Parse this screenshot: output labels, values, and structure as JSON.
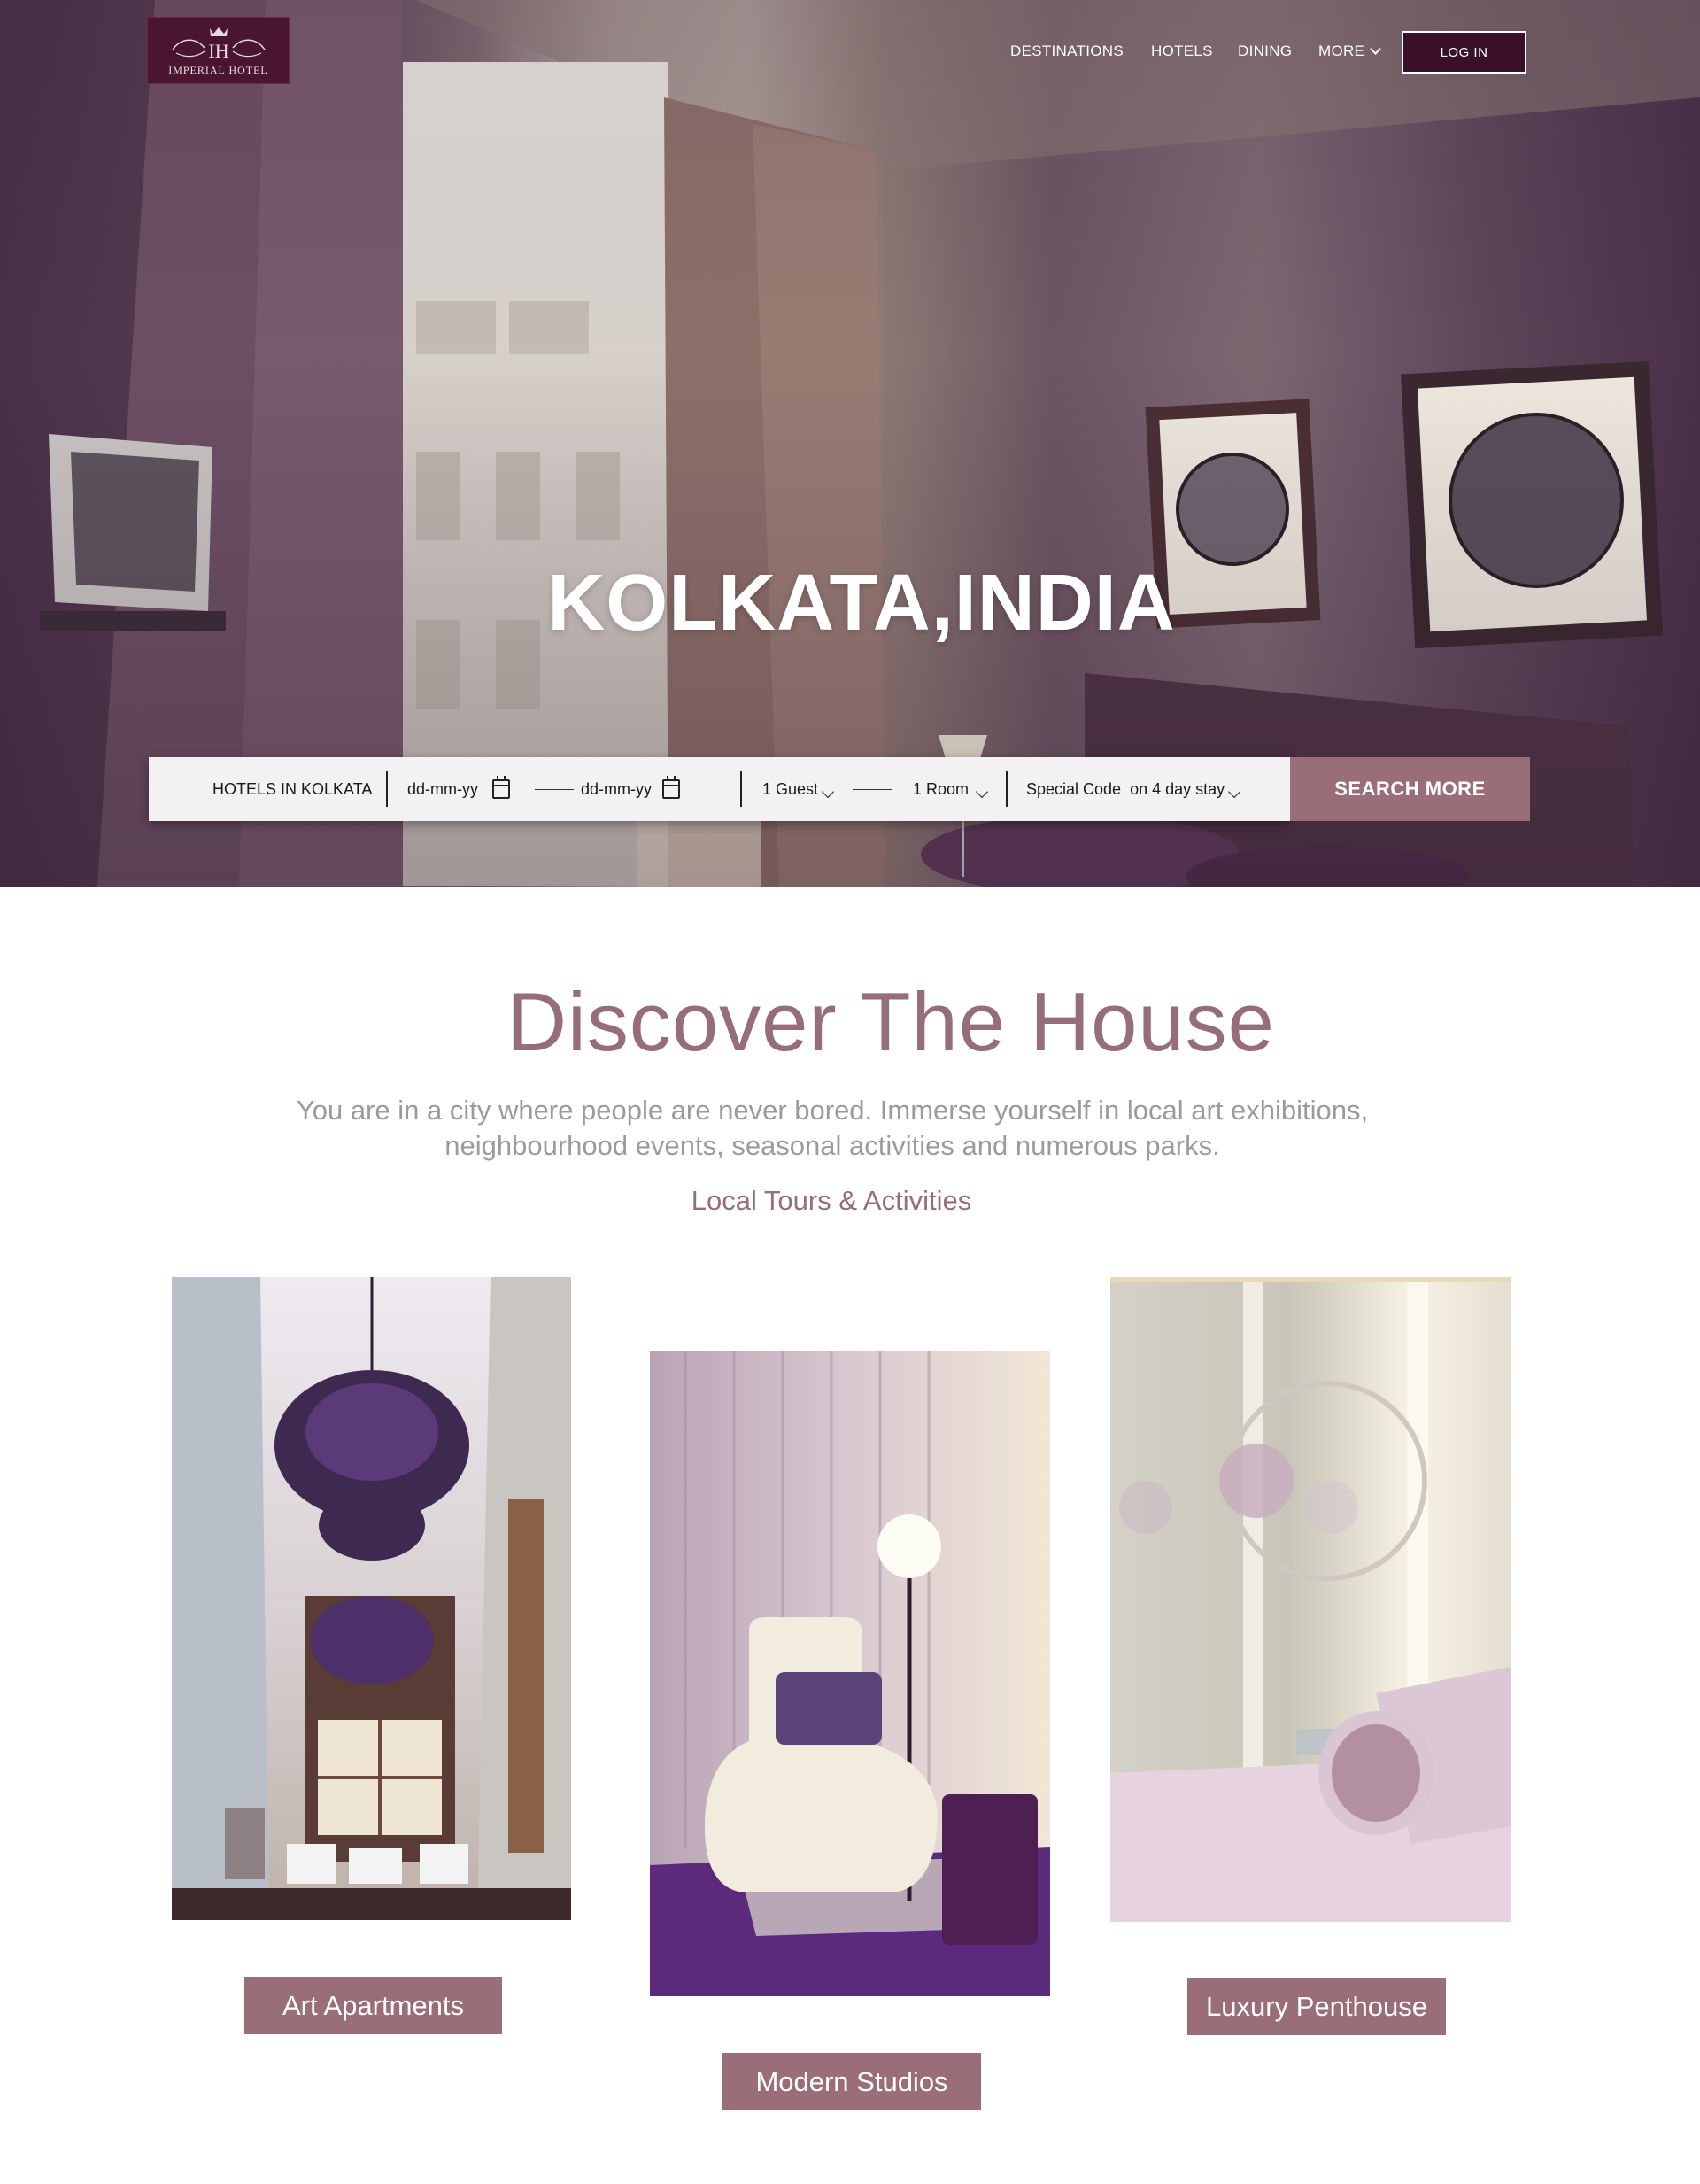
{
  "brand": {
    "name": "IMPERIAL HOTEL",
    "logo_color": "#4a1530"
  },
  "nav": {
    "items": [
      "DESTINATIONS",
      "HOTELS",
      "DINING",
      "MORE"
    ],
    "login": "LOG IN"
  },
  "hero": {
    "title": "KOLKATA,INDIA"
  },
  "booking": {
    "location": "HOTELS IN KOLKATA",
    "check_in_placeholder": "dd-mm-yy",
    "check_out_placeholder": "dd-mm-yy",
    "guests": "1 Guest",
    "rooms": "1 Room",
    "special_code": "Special Code",
    "special_offer": "on 4 day stay",
    "search_button": "SEARCH MORE"
  },
  "discover": {
    "title": "Discover The House",
    "subtitle_line1": "You are in a city where people are never bored. Immerse yourself in local art exhibitions,",
    "subtitle_line2": "neighbourhood events, seasonal activities and numerous parks.",
    "link": "Local Tours & Activities"
  },
  "cards": [
    {
      "label": "Art Apartments",
      "icon": "chandelier-photo"
    },
    {
      "label": "Modern Studios",
      "icon": "lounge-chair-photo"
    },
    {
      "label": "Luxury Penthouse",
      "icon": "bedroom-photo"
    }
  ],
  "colors": {
    "accent": "#9a6e78",
    "title": "#956e79",
    "body_text": "#9b9b9b",
    "login_bg": "#3a0f2a"
  }
}
